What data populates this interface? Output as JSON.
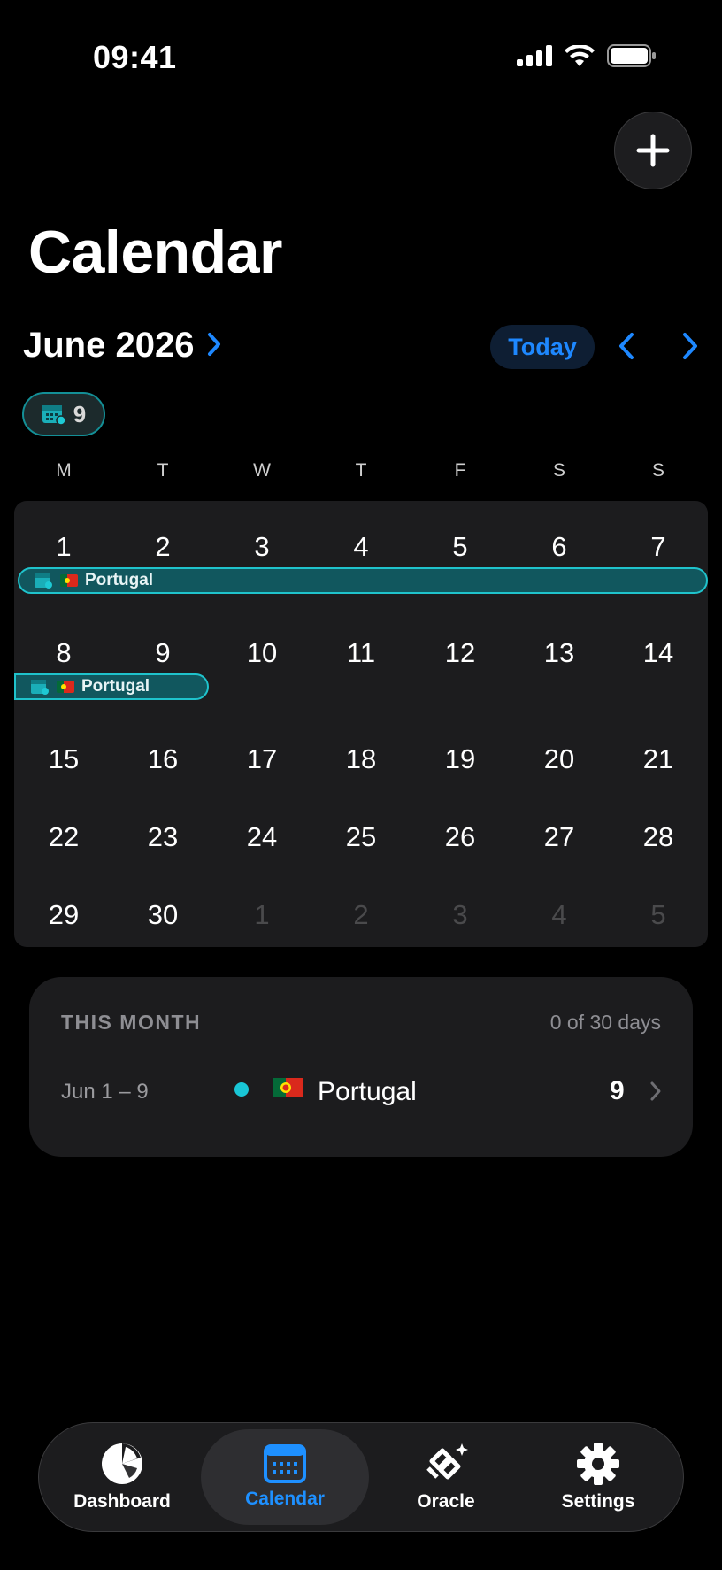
{
  "status": {
    "time": "09:41"
  },
  "title": "Calendar",
  "header": {
    "month": "June 2026",
    "today_label": "Today"
  },
  "trip_count": "9",
  "weekdays": [
    "M",
    "T",
    "W",
    "T",
    "F",
    "S",
    "S"
  ],
  "calendar": {
    "weeks": [
      [
        "1",
        "2",
        "3",
        "4",
        "5",
        "6",
        "7"
      ],
      [
        "8",
        "9",
        "10",
        "11",
        "12",
        "13",
        "14"
      ],
      [
        "15",
        "16",
        "17",
        "18",
        "19",
        "20",
        "21"
      ],
      [
        "22",
        "23",
        "24",
        "25",
        "26",
        "27",
        "28"
      ],
      [
        "29",
        "30",
        "1",
        "2",
        "3",
        "4",
        "5"
      ]
    ],
    "events": [
      {
        "label": "Portugal",
        "flag": "Portugal"
      },
      {
        "label": "Portugal",
        "flag": "Portugal"
      }
    ]
  },
  "summary": {
    "heading": "THIS MONTH",
    "count_text": "0 of 30 days",
    "rows": [
      {
        "range": "Jun 1 – 9",
        "country": "Portugal",
        "days": "9",
        "dot_color": "#19c6d6"
      }
    ]
  },
  "tabs": [
    {
      "label": "Dashboard",
      "icon": "pie-chart-icon"
    },
    {
      "label": "Calendar",
      "icon": "calendar-icon",
      "active": true
    },
    {
      "label": "Oracle",
      "icon": "oracle-icon"
    },
    {
      "label": "Settings",
      "icon": "gear-icon"
    }
  ],
  "colors": {
    "accent": "#1e88ff",
    "event_fill": "#11575e",
    "event_border": "#1fc3cc"
  }
}
